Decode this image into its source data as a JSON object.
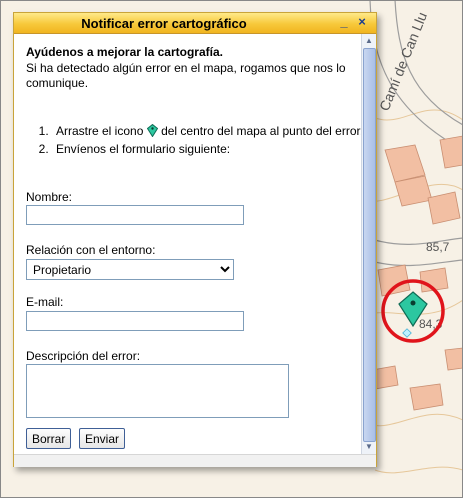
{
  "dialog": {
    "title": "Notificar error cartográfico",
    "minimize_label": "_",
    "close_label": "×"
  },
  "intro": {
    "heading": "Ayúdenos a mejorar la cartografía.",
    "text": "Si ha detectado algún error en el mapa, rogamos que nos lo comunique."
  },
  "steps": {
    "step1_before": "Arrastre el icono",
    "step1_after": "del centro del mapa al punto del error.",
    "step2": "Envíenos el formulario siguiente:"
  },
  "form": {
    "name_label": "Nombre:",
    "name_value": "",
    "relation_label": "Relación con el entorno:",
    "relation_selected": "Propietario",
    "email_label": "E-mail:",
    "email_value": "",
    "description_label": "Descripción del error:",
    "description_value": "",
    "clear_button": "Borrar",
    "submit_button": "Enviar"
  },
  "map": {
    "street_label": "Camí de Can Llu",
    "elevation_1": "85,7",
    "elevation_2": "84,3"
  },
  "colors": {
    "titlebar": "#f7c83a",
    "marker": "#2cc7a0",
    "highlight_circle": "#e0141b"
  },
  "icons": {
    "marker": "map-pin-icon"
  }
}
